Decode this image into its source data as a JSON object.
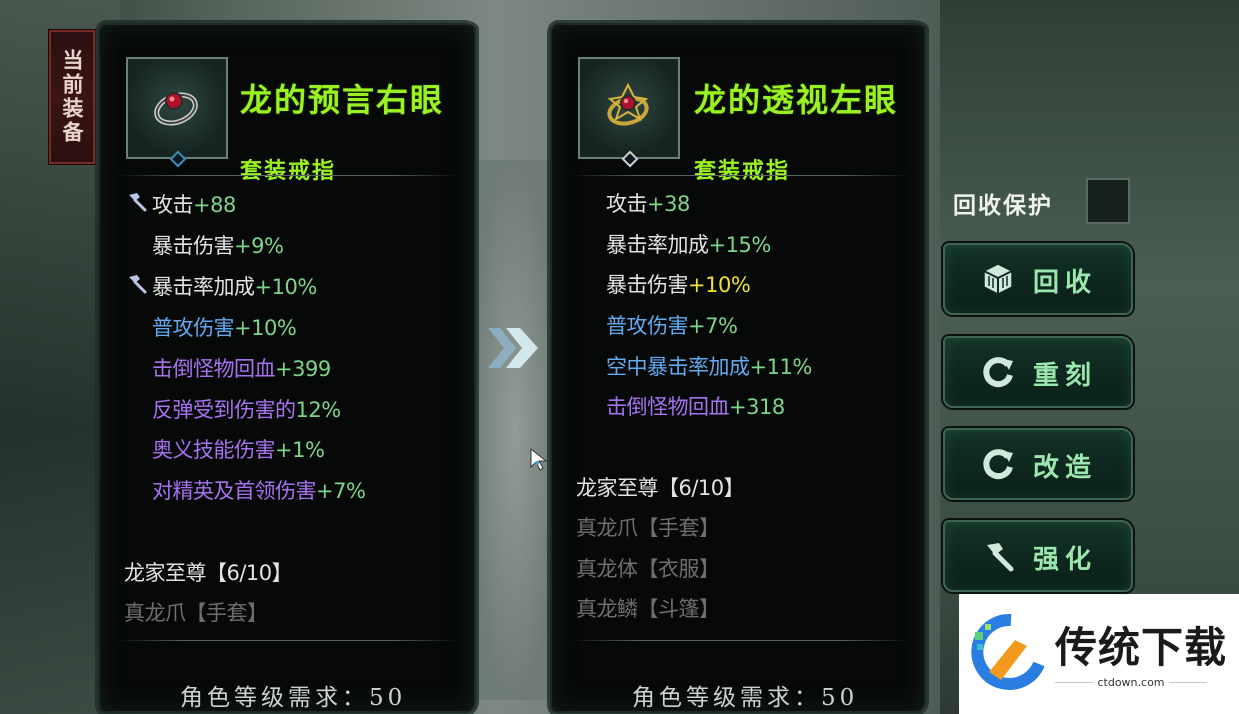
{
  "tag": {
    "text": "当前装备"
  },
  "left": {
    "name": "龙的预言右眼",
    "type": "套装戒指",
    "stats": [
      {
        "label": "攻击",
        "value": "+88",
        "color": "#e3e3e3",
        "value_color": "#7fd48b",
        "icon": "hammer-icon"
      },
      {
        "label": "暴击伤害",
        "value": "+9%",
        "color": "#e3e3e3",
        "value_color": "#7fd48b"
      },
      {
        "label": "暴击率加成",
        "value": "+10%",
        "color": "#e3e3e3",
        "value_color": "#7fd48b",
        "icon": "hammer-icon"
      },
      {
        "label": "普攻伤害",
        "value": "+10%",
        "color": "#63aaf1",
        "value_color": "#7fd48b"
      },
      {
        "label": "击倒怪物回血",
        "value": "+399",
        "color": "#a672f0",
        "value_color": "#7fd48b"
      },
      {
        "label": "反弹受到伤害的",
        "value": "12%",
        "color": "#a672f0",
        "value_color": "#7fd48b"
      },
      {
        "label": "奥义技能伤害",
        "value": "+1%",
        "color": "#a672f0",
        "value_color": "#7fd48b"
      },
      {
        "label": "对精英及首领伤害",
        "value": "+7%",
        "color": "#a672f0",
        "value_color": "#7fd48b"
      }
    ],
    "set_title": "龙家至尊【6/10】",
    "set_items": [
      "真龙爪【手套】"
    ],
    "requirement": "角色等级需求：50"
  },
  "right": {
    "name": "龙的透视左眼",
    "type": "套装戒指",
    "stats": [
      {
        "label": "攻击",
        "value": "+38",
        "color": "#e3e3e3",
        "value_color": "#7fd48b"
      },
      {
        "label": "暴击率加成",
        "value": "+15%",
        "color": "#e3e3e3",
        "value_color": "#7fd48b"
      },
      {
        "label": "暴击伤害",
        "value": "+10%",
        "color": "#e3e3e3",
        "value_color": "#f0e13a"
      },
      {
        "label": "普攻伤害",
        "value": "+7%",
        "color": "#63aaf1",
        "value_color": "#7fd48b"
      },
      {
        "label": "空中暴击率加成",
        "value": "+11%",
        "color": "#63aaf1",
        "value_color": "#7fd48b"
      },
      {
        "label": "击倒怪物回血",
        "value": "+318",
        "color": "#a672f0",
        "value_color": "#7fd48b"
      }
    ],
    "set_title": "龙家至尊【6/10】",
    "set_items": [
      "真龙爪【手套】",
      "真龙体【衣服】",
      "真龙鳞【斗篷】"
    ],
    "requirement": "角色等级需求：50"
  },
  "side": {
    "protect_label": "回收保护",
    "buttons": [
      {
        "label": "回收",
        "icon": "recycle-cube-icon"
      },
      {
        "label": "重刻",
        "icon": "refresh-icon"
      },
      {
        "label": "改造",
        "icon": "refresh-icon"
      },
      {
        "label": "强化",
        "icon": "hammer-icon"
      }
    ]
  },
  "watermark": {
    "brand": "传统下载",
    "url": "ctdown.com"
  },
  "colors": {
    "name_green": "#9bf222",
    "stat_green": "#7fd48b",
    "blue": "#63aaf1",
    "purple": "#a672f0",
    "yellow": "#f0e13a"
  }
}
